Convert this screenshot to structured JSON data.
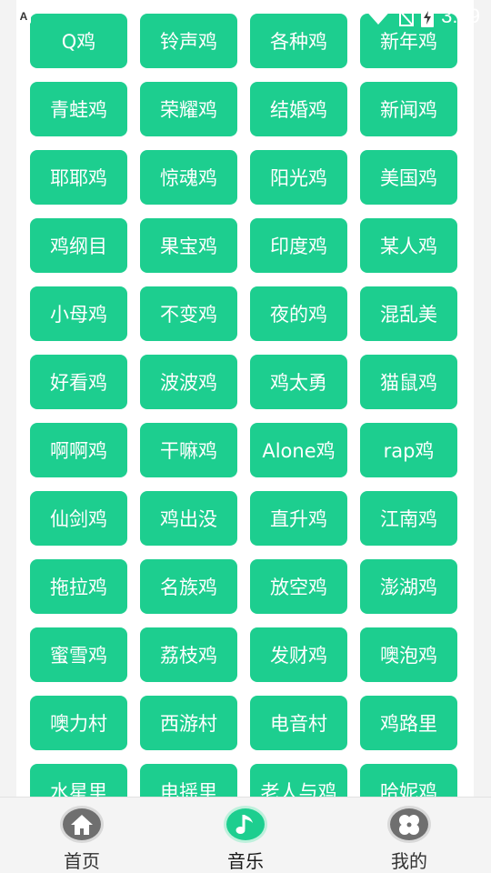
{
  "status_bar": {
    "notification_letter": "A",
    "time": "3:49"
  },
  "tiles": [
    "Q鸡",
    "铃声鸡",
    "各种鸡",
    "新年鸡",
    "青蛙鸡",
    "荣耀鸡",
    "结婚鸡",
    "新闻鸡",
    "耶耶鸡",
    "惊魂鸡",
    "阳光鸡",
    "美国鸡",
    "鸡纲目",
    "果宝鸡",
    "印度鸡",
    "某人鸡",
    "小母鸡",
    "不变鸡",
    "夜的鸡",
    "混乱美",
    "好看鸡",
    "波波鸡",
    "鸡太勇",
    "猫鼠鸡",
    "啊啊鸡",
    "干嘛鸡",
    "Alone鸡",
    "rap鸡",
    "仙剑鸡",
    "鸡出没",
    "直升鸡",
    "江南鸡",
    "拖拉鸡",
    "名族鸡",
    "放空鸡",
    "澎湖鸡",
    "蜜雪鸡",
    "荔枝鸡",
    "发财鸡",
    "噢泡鸡",
    "噢力村",
    "西游村",
    "电音村",
    "鸡路里",
    "水星里",
    "电摇里",
    "老人与鸡",
    "哈妮鸡"
  ],
  "bottom_nav": {
    "home_label": "首页",
    "music_label": "音乐",
    "mine_label": "我的",
    "active": "music"
  },
  "colors": {
    "accent": "#1dce8f",
    "icon_inactive": "#6f6f6f"
  }
}
